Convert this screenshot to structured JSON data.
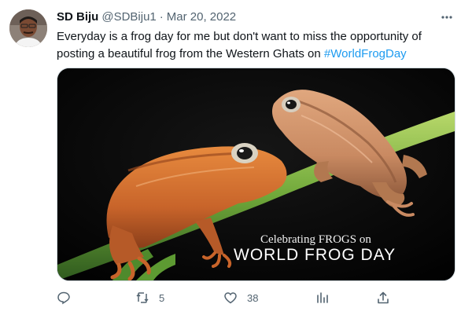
{
  "tweet": {
    "author_name": "SD Biju",
    "handle": "@SDBiju1",
    "separator": "·",
    "date": "Mar 20, 2022",
    "text_part1": "Everyday is a frog day for me but don't want to miss the opportunity of posting a beautiful frog from the Western Ghats on ",
    "hashtag": "#WorldFrogDay",
    "image_caption_line1": "Celebrating FROGS on",
    "image_caption_line2": "WORLD FROG DAY"
  },
  "actions": {
    "reply_count": "",
    "retweet_count": "5",
    "like_count": "38",
    "views_count": ""
  },
  "colors": {
    "text": "#0f1419",
    "secondary": "#536471",
    "link": "#1d9bf0",
    "accent_red": "#d42a1f"
  },
  "icons": [
    "more-icon",
    "reply-icon",
    "retweet-icon",
    "like-icon",
    "views-icon",
    "share-icon"
  ]
}
